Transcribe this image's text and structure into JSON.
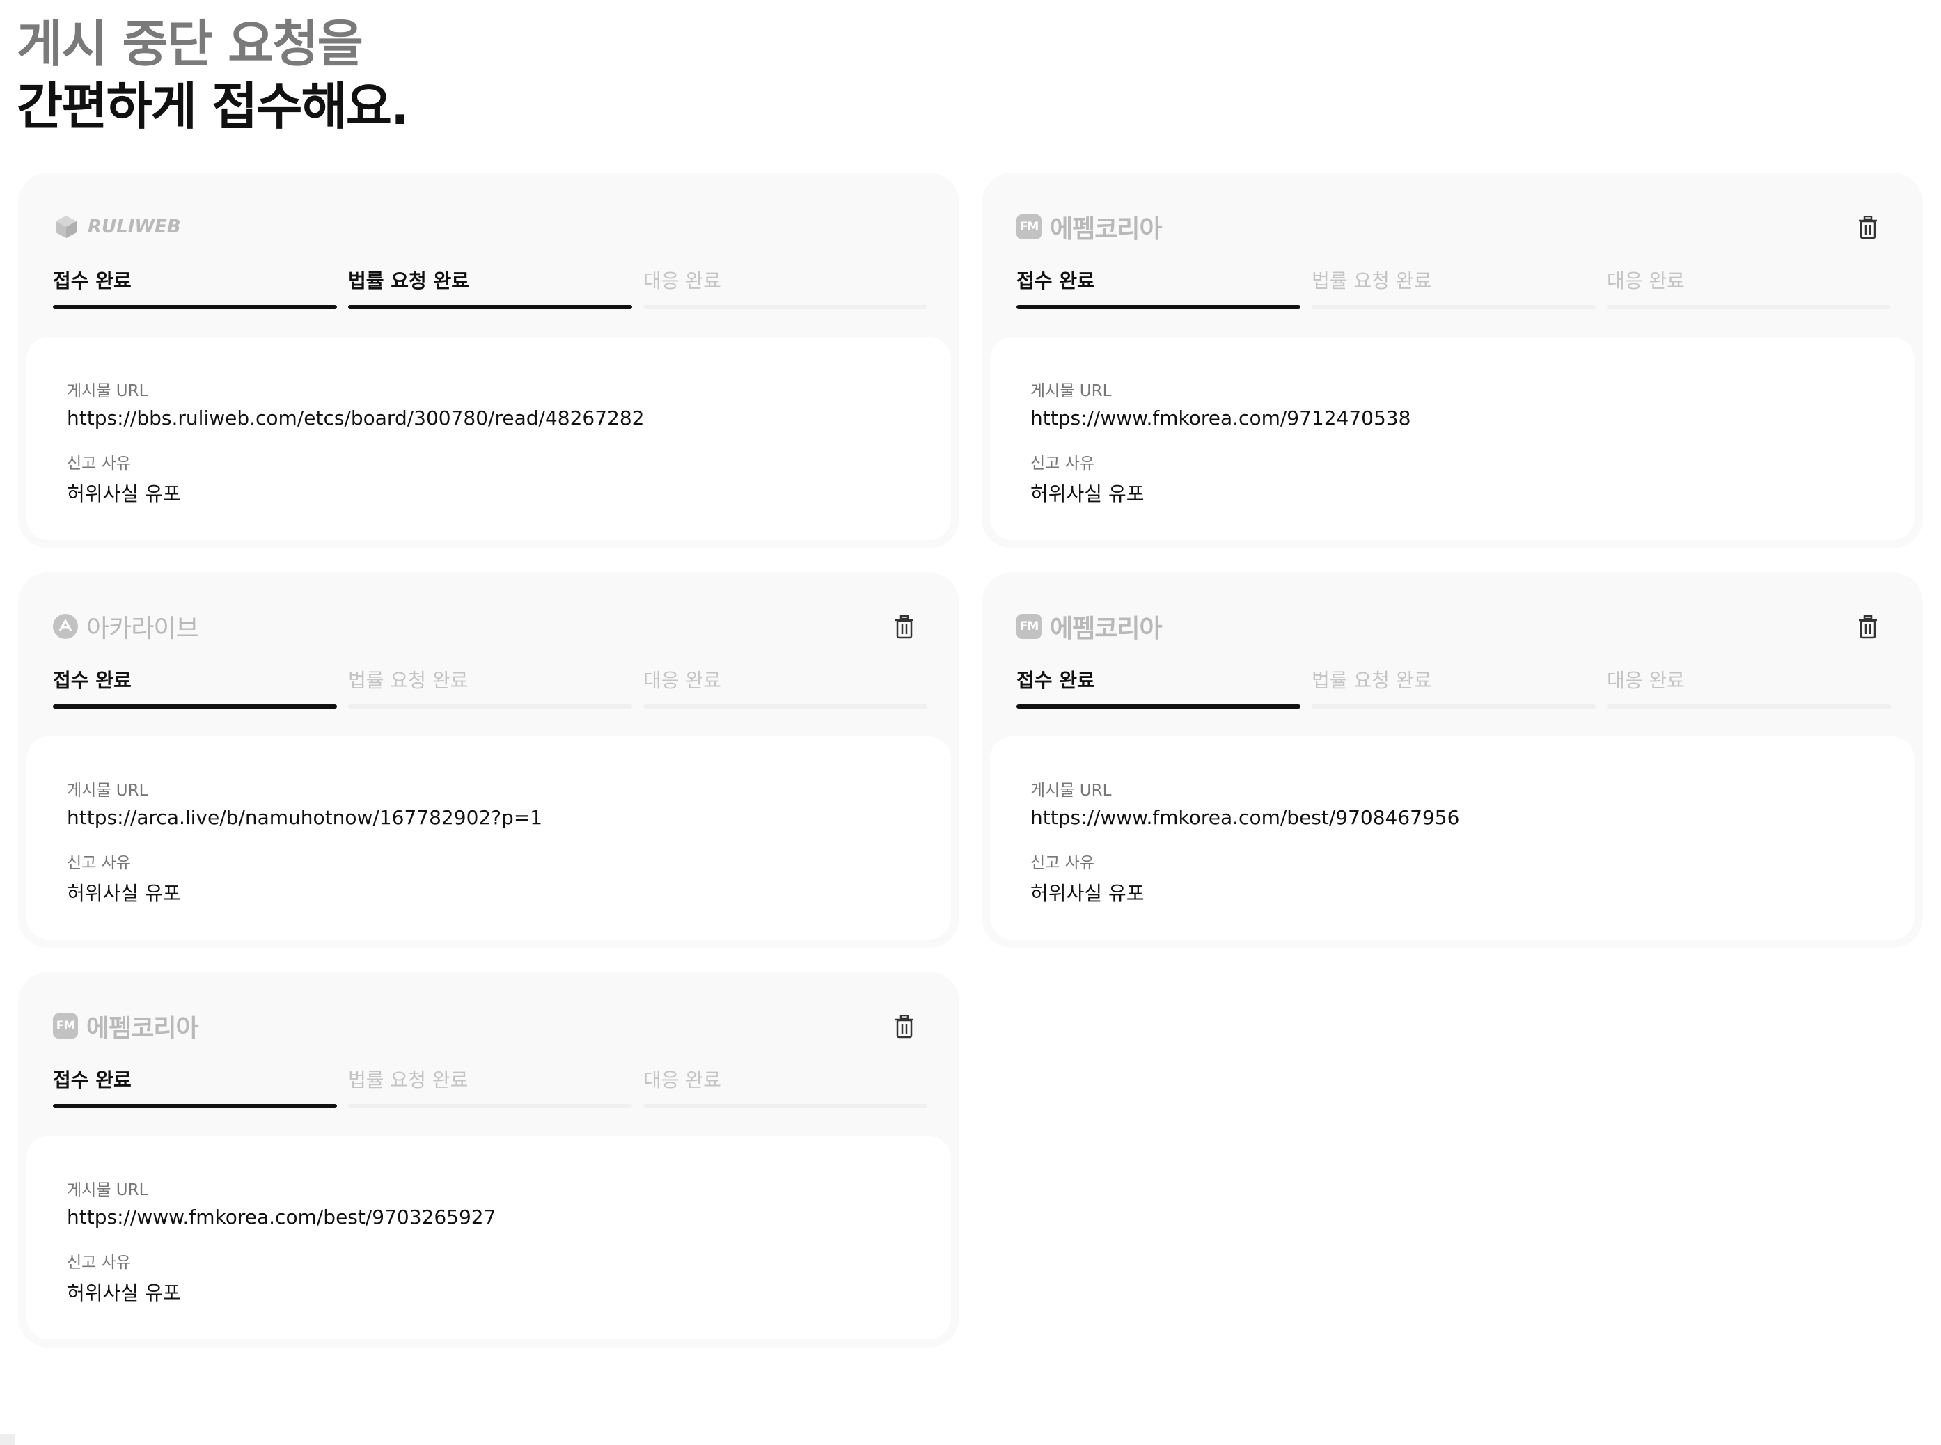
{
  "headline": {
    "line1": "게시 중단 요청을",
    "line2": "간편하게 접수해요."
  },
  "cards": [
    {
      "site": "RULIWEB",
      "logo_badge": "",
      "show_trash": false,
      "steps": [
        "접수 완료",
        "법률 요청 완료",
        "대응 완료"
      ],
      "active_steps": 2,
      "url_label": "게시물 URL",
      "url": "https://bbs.ruliweb.com/etcs/board/300780/read/48267282",
      "reason_label": "신고 사유",
      "reason": "허위사실 유포"
    },
    {
      "site": "에펨코리아",
      "logo_badge": "FM",
      "show_trash": true,
      "steps": [
        "접수 완료",
        "법률 요청 완료",
        "대응 완료"
      ],
      "active_steps": 1,
      "url_label": "게시물 URL",
      "url": "https://www.fmkorea.com/9712470538",
      "reason_label": "신고 사유",
      "reason": "허위사실 유포"
    },
    {
      "site": "아카라이브",
      "logo_badge": "",
      "show_trash": true,
      "steps": [
        "접수 완료",
        "법률 요청 완료",
        "대응 완료"
      ],
      "active_steps": 1,
      "url_label": "게시물 URL",
      "url": "https://arca.live/b/namuhotnow/167782902?p=1",
      "reason_label": "신고 사유",
      "reason": "허위사실 유포"
    },
    {
      "site": "에펨코리아",
      "logo_badge": "FM",
      "show_trash": true,
      "steps": [
        "접수 완료",
        "법률 요청 완료",
        "대응 완료"
      ],
      "active_steps": 1,
      "url_label": "게시물 URL",
      "url": "https://www.fmkorea.com/best/9708467956",
      "reason_label": "신고 사유",
      "reason": "허위사실 유포"
    },
    {
      "site": "에펨코리아",
      "logo_badge": "FM",
      "show_trash": true,
      "steps": [
        "접수 완료",
        "법률 요청 완료",
        "대응 완료"
      ],
      "active_steps": 1,
      "url_label": "게시물 URL",
      "url": "https://www.fmkorea.com/best/9703265927",
      "reason_label": "신고 사유",
      "reason": "허위사실 유포"
    }
  ],
  "colors": {
    "card_bg": "#f9f9f9",
    "active_step": "#111111",
    "inactive_step": "#c4c4c4",
    "logo_gray": "#b9b9b9"
  },
  "icons": {
    "delete": "trash-icon",
    "ruliweb": "ruliweb-cube-icon",
    "arca": "arca-live-icon",
    "fmkorea": "fm-badge-icon"
  }
}
